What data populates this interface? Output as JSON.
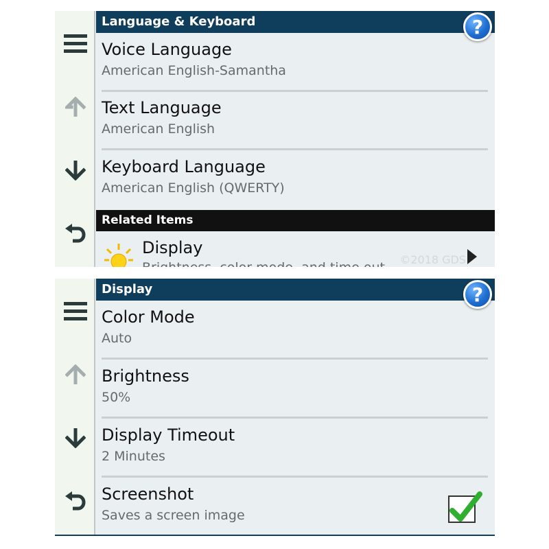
{
  "screen1": {
    "title": "Language & Keyboard",
    "help_label": "?",
    "items": [
      {
        "label": "Voice Language",
        "value": "American English-Samantha"
      },
      {
        "label": "Text Language",
        "value": "American English"
      },
      {
        "label": "Keyboard Language",
        "value": "American English (QWERTY)"
      }
    ],
    "related_header": "Related Items",
    "related_item": {
      "label": "Display",
      "value": "Brightness, color mode, and time out",
      "icon": "sun-icon"
    },
    "watermark": "©2018 GDS"
  },
  "screen2": {
    "title": "Display",
    "help_label": "?",
    "items": [
      {
        "label": "Color Mode",
        "value": "Auto"
      },
      {
        "label": "Brightness",
        "value": "50%"
      },
      {
        "label": "Display Timeout",
        "value": "2 Minutes"
      },
      {
        "label": "Screenshot",
        "value": "Saves a screen image",
        "checked": true
      }
    ]
  },
  "sidebar_icons": [
    "menu-icon",
    "arrow-up-icon",
    "arrow-down-icon",
    "back-icon"
  ],
  "colors": {
    "title_bar": "#0f3d5c",
    "section_bar": "#111111",
    "content_bg": "#eaf0f1",
    "sidebar_bg": "#f1f7ef",
    "checkmark": "#2fae2f",
    "help_button": "#1f6fd1"
  }
}
